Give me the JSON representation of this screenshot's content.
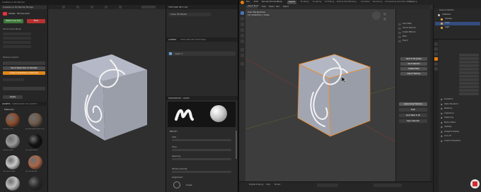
{
  "left_app": {
    "window_title": "Substance 3D Painter",
    "addon_panel": {
      "header": "Substance 3D Painter Bridge",
      "brand": "Adobe",
      "subtitle": "SP Live Link",
      "start_button": "Start Live Link",
      "stop_button": "Stop",
      "section_mesh": "Send mesh Mode",
      "section_texture": "Texture Import",
      "tabs": [
        "Materials",
        "Substance",
        "Textures"
      ],
      "send_button": "Send Selection to Painter",
      "import_button": "Import Substance Textures",
      "sync_button": "Sync Materials",
      "apply_button": "Apply",
      "shelf_tabs": [
        "ASSETS",
        "SUBSTANCE 3D ASSETS"
      ],
      "shelf_section": "Materials",
      "materials": [
        {
          "name": "Bronze Crust",
          "color": "#8a4d2f"
        },
        {
          "name": "Bronze Liquid Rock Dry",
          "color": "#6f5a4a"
        },
        {
          "name": "Carbon Fiber",
          "color": "#9a9a9a"
        },
        {
          "name": "Car Paint Black",
          "color": "#121212"
        },
        {
          "name": "Car Paint Silver",
          "color": "#c9c9c9"
        },
        {
          "name": "Car Terracotta",
          "color": "#a9674a"
        },
        {
          "name": "Chrome",
          "color": "#bfbfbf"
        },
        {
          "name": "Coal",
          "color": "#2a2a2a"
        }
      ]
    },
    "layers_panel": {
      "header": "TEXTURE SET LIST",
      "texture_set": "Cube 3D Model",
      "tabs": [
        "LAYERS",
        "TEXTURE SET SETTINGS"
      ],
      "layer_name": "Layer 1"
    },
    "properties_panel": {
      "header": "PROPERTIES - PAINT",
      "section": "BRUSH",
      "fields": [
        "Size",
        "Flow",
        "Spacing",
        "Stroke opacity",
        "Angle"
      ],
      "alignment_label": "Alignment"
    }
  },
  "blender": {
    "menus": [
      "File",
      "Edit",
      "Render",
      "Window",
      "Help"
    ],
    "workspace_tabs": [
      "Layout",
      "Modeling",
      "Sculpting",
      "UV Editing",
      "Texture Paint",
      "Shading",
      "Animation",
      "Rendering",
      "Compositing",
      "Geometry Nodes",
      "Scripting"
    ],
    "active_tab": "Layout",
    "viewport_mode": "Object Mode",
    "viewport_info": [
      "User Perspective",
      "(1) Collection | Cube"
    ],
    "header_menus": [
      "View",
      "Select",
      "Add",
      "Object"
    ],
    "sp_panel": {
      "items": [
        "Send Mesh",
        "Import Textures",
        "Create Material",
        "Bake",
        "Export"
      ],
      "buttons": [
        "Send to SP (Cube)",
        "Send Selected",
        "Update Mesh",
        "Import Textures"
      ],
      "bottom_buttons": [
        "Apply Saved Textures",
        "Clear",
        "Send Mesh to SP",
        "Open Selected"
      ]
    },
    "outliner": {
      "title": "Scene Collection",
      "items": [
        "Collection",
        "Camera",
        "Cube",
        "Light"
      ]
    },
    "properties_sections": [
      "Transform",
      "Delta Transform",
      "Relations",
      "Collections",
      "Instancing",
      "Motion Paths",
      "Visibility",
      "Viewport Display",
      "Line Art",
      "Custom Properties"
    ],
    "timeline": [
      "Playback",
      "Keying",
      "View",
      "Marker"
    ]
  }
}
